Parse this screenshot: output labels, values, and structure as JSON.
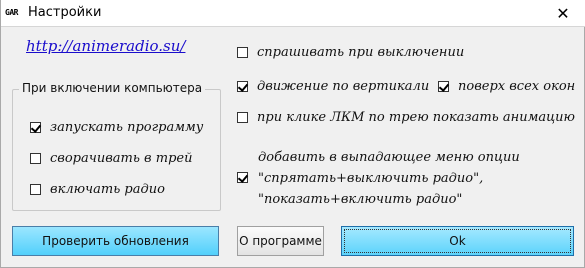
{
  "window": {
    "icon_text": "GAR",
    "title": "Настройки",
    "close_glyph": "✕"
  },
  "link": {
    "text": "http://animeradio.su/"
  },
  "startup_group": {
    "title": "При включении компьютера",
    "items": [
      {
        "label": "запускать программу",
        "checked": true
      },
      {
        "label": "сворачивать в трей",
        "checked": false
      },
      {
        "label": "включать радио",
        "checked": false
      }
    ]
  },
  "options": {
    "ask_on_exit": {
      "label": "спрашивать при выключении",
      "checked": false
    },
    "vertical_move": {
      "label": "движение по вертикали",
      "checked": true
    },
    "always_on_top": {
      "label": "поверх всех окон",
      "checked": true
    },
    "tray_click_anim": {
      "label": "при клике ЛКМ по трею показать анимацию",
      "checked": false
    },
    "dropdown_options": {
      "checked": true,
      "line1": "добавить в выпадающее меню опции",
      "line2": "\"спрятать+выключить радио\",",
      "line3": "\"показать+включить радио\""
    }
  },
  "buttons": {
    "check_updates": "Проверить обновления",
    "about": "О программе",
    "ok": "Ok"
  }
}
